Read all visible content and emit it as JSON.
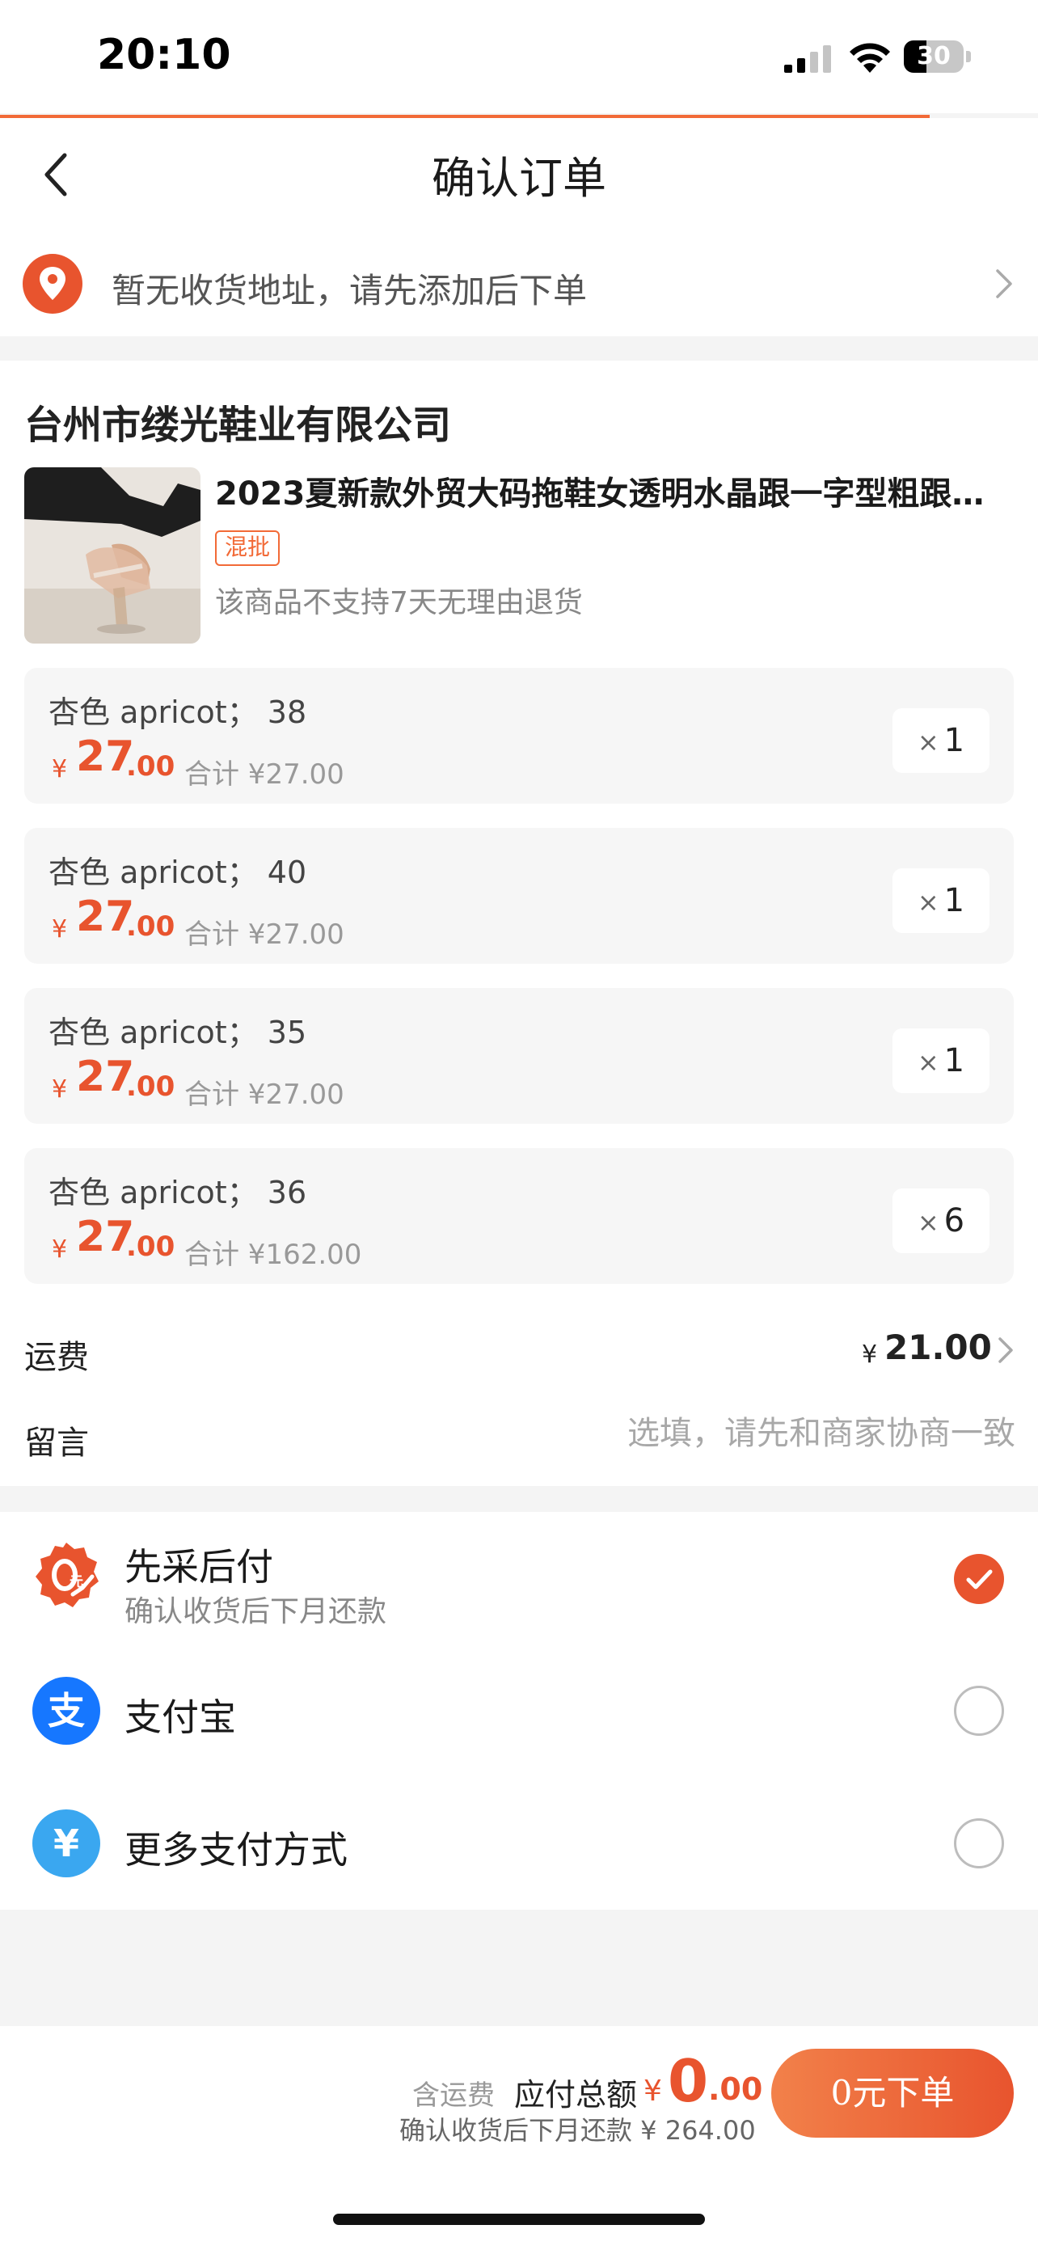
{
  "status_bar": {
    "time": "20:10",
    "battery": "30"
  },
  "nav": {
    "title": "确认订单"
  },
  "address": {
    "text": "暂无收货地址，请先添加后下单"
  },
  "shop": {
    "name": "台州市缕光鞋业有限公司"
  },
  "product": {
    "title": "2023夏新款外贸大码拖鞋女透明水晶跟一字型粗跟高跟...",
    "badge": "混批",
    "return_note": "该商品不支持7天无理由退货"
  },
  "skus": [
    {
      "spec": "杏色 apricot； 38",
      "yen": "¥",
      "price_int": "27",
      "price_dec": ".00",
      "subtotal": "合计 ¥27.00",
      "x": "×",
      "qty": "1"
    },
    {
      "spec": "杏色 apricot； 40",
      "yen": "¥",
      "price_int": "27",
      "price_dec": ".00",
      "subtotal": "合计 ¥27.00",
      "x": "×",
      "qty": "1"
    },
    {
      "spec": "杏色 apricot； 35",
      "yen": "¥",
      "price_int": "27",
      "price_dec": ".00",
      "subtotal": "合计 ¥27.00",
      "x": "×",
      "qty": "1"
    },
    {
      "spec": "杏色 apricot； 36",
      "yen": "¥",
      "price_int": "27",
      "price_dec": ".00",
      "subtotal": "合计 ¥162.00",
      "x": "×",
      "qty": "6"
    }
  ],
  "shipping": {
    "label": "运费",
    "yen": "¥",
    "value": "21.00"
  },
  "message": {
    "label": "留言",
    "placeholder": "选填，请先和商家协商一致"
  },
  "payment": {
    "options": [
      {
        "name": "先采后付",
        "desc": "确认收货后下月还款",
        "icon": "0-yuan-badge-icon",
        "selected": true
      },
      {
        "name": "支付宝",
        "icon": "alipay-icon",
        "selected": false
      },
      {
        "name": "更多支付方式",
        "icon": "yen-circle-icon",
        "selected": false
      }
    ]
  },
  "footer": {
    "incl_shipping": "含运费",
    "total_label": "应付总额",
    "yen": "¥",
    "total_int": "0",
    "total_dec": ".00",
    "defer_note": "确认收货后下月还款 ¥ 264.00",
    "submit": "0元下单"
  },
  "colors": {
    "accent": "#e8542e",
    "accent_light": "#f2814a",
    "alipay": "#1677ff",
    "more_pay": "#3aa7f0"
  }
}
